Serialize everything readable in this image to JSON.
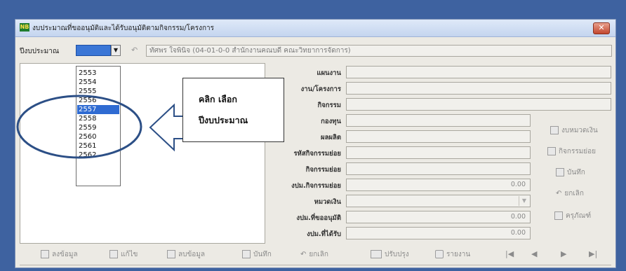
{
  "window": {
    "title": "งบประมาณที่ขออนุมัติและได้รับอนุมัติตามกิจกรรม/โครงการ",
    "icon_text": "NB",
    "close_label": "✕"
  },
  "filter": {
    "year_label": "ปีงบประมาณ",
    "year_value": "",
    "owner_value": "ทัศพร ใจพินิจ  (04-01-0-0 สำนักงานคณบดี คณะวิทยาการจัดการ)"
  },
  "year_dropdown": {
    "options": [
      "2553",
      "2554",
      "2555",
      "2556",
      "2557",
      "2558",
      "2559",
      "2560",
      "2561",
      "2562"
    ],
    "selected": "2557"
  },
  "callout": {
    "line1": "คลิก  เลือก",
    "line2": "ปีงบประมาณ"
  },
  "form": {
    "plan_label": "แผนงาน",
    "project_label": "งาน/โครงการ",
    "activity_label": "กิจกรรม",
    "fund_label": "กองทุน",
    "output_label": "ผลผลิต",
    "subactivity_code_label": "รหัสกิจกรรมย่อย",
    "subactivity_label": "กิจกรรมย่อย",
    "sub_budget_label": "งปม.กิจกรรมย่อย",
    "sub_budget_value": "0.00",
    "category_label": "หมวดเงิน",
    "requested_label": "งปม.ที่ขออนุมัติ",
    "requested_value": "0.00",
    "received_label": "งปม.ที่ได้รับ",
    "received_value": "0.00"
  },
  "side_buttons": {
    "budget_category": "งบหมวดเงิน",
    "subactivity": "กิจกรรมย่อย",
    "save": "บันทึก",
    "cancel": "ยกเลิก",
    "durable": "ครุภัณฑ์"
  },
  "toolbar": {
    "add": "ลงข้อมูล",
    "edit": "แก้ไข",
    "delete": "ลบข้อมูล",
    "save": "บันทึก",
    "cancel": "ยกเลิก",
    "refresh": "ปรับปรุง",
    "report": "รายงาน",
    "first": "|◀",
    "prev": "◀",
    "next": "▶",
    "last": "▶|"
  },
  "colors": {
    "frame": "#3e62a0",
    "window_bg": "#eceae4",
    "selected_item": "#2f6bd2",
    "callout_ellipse": "#2c4f86"
  }
}
